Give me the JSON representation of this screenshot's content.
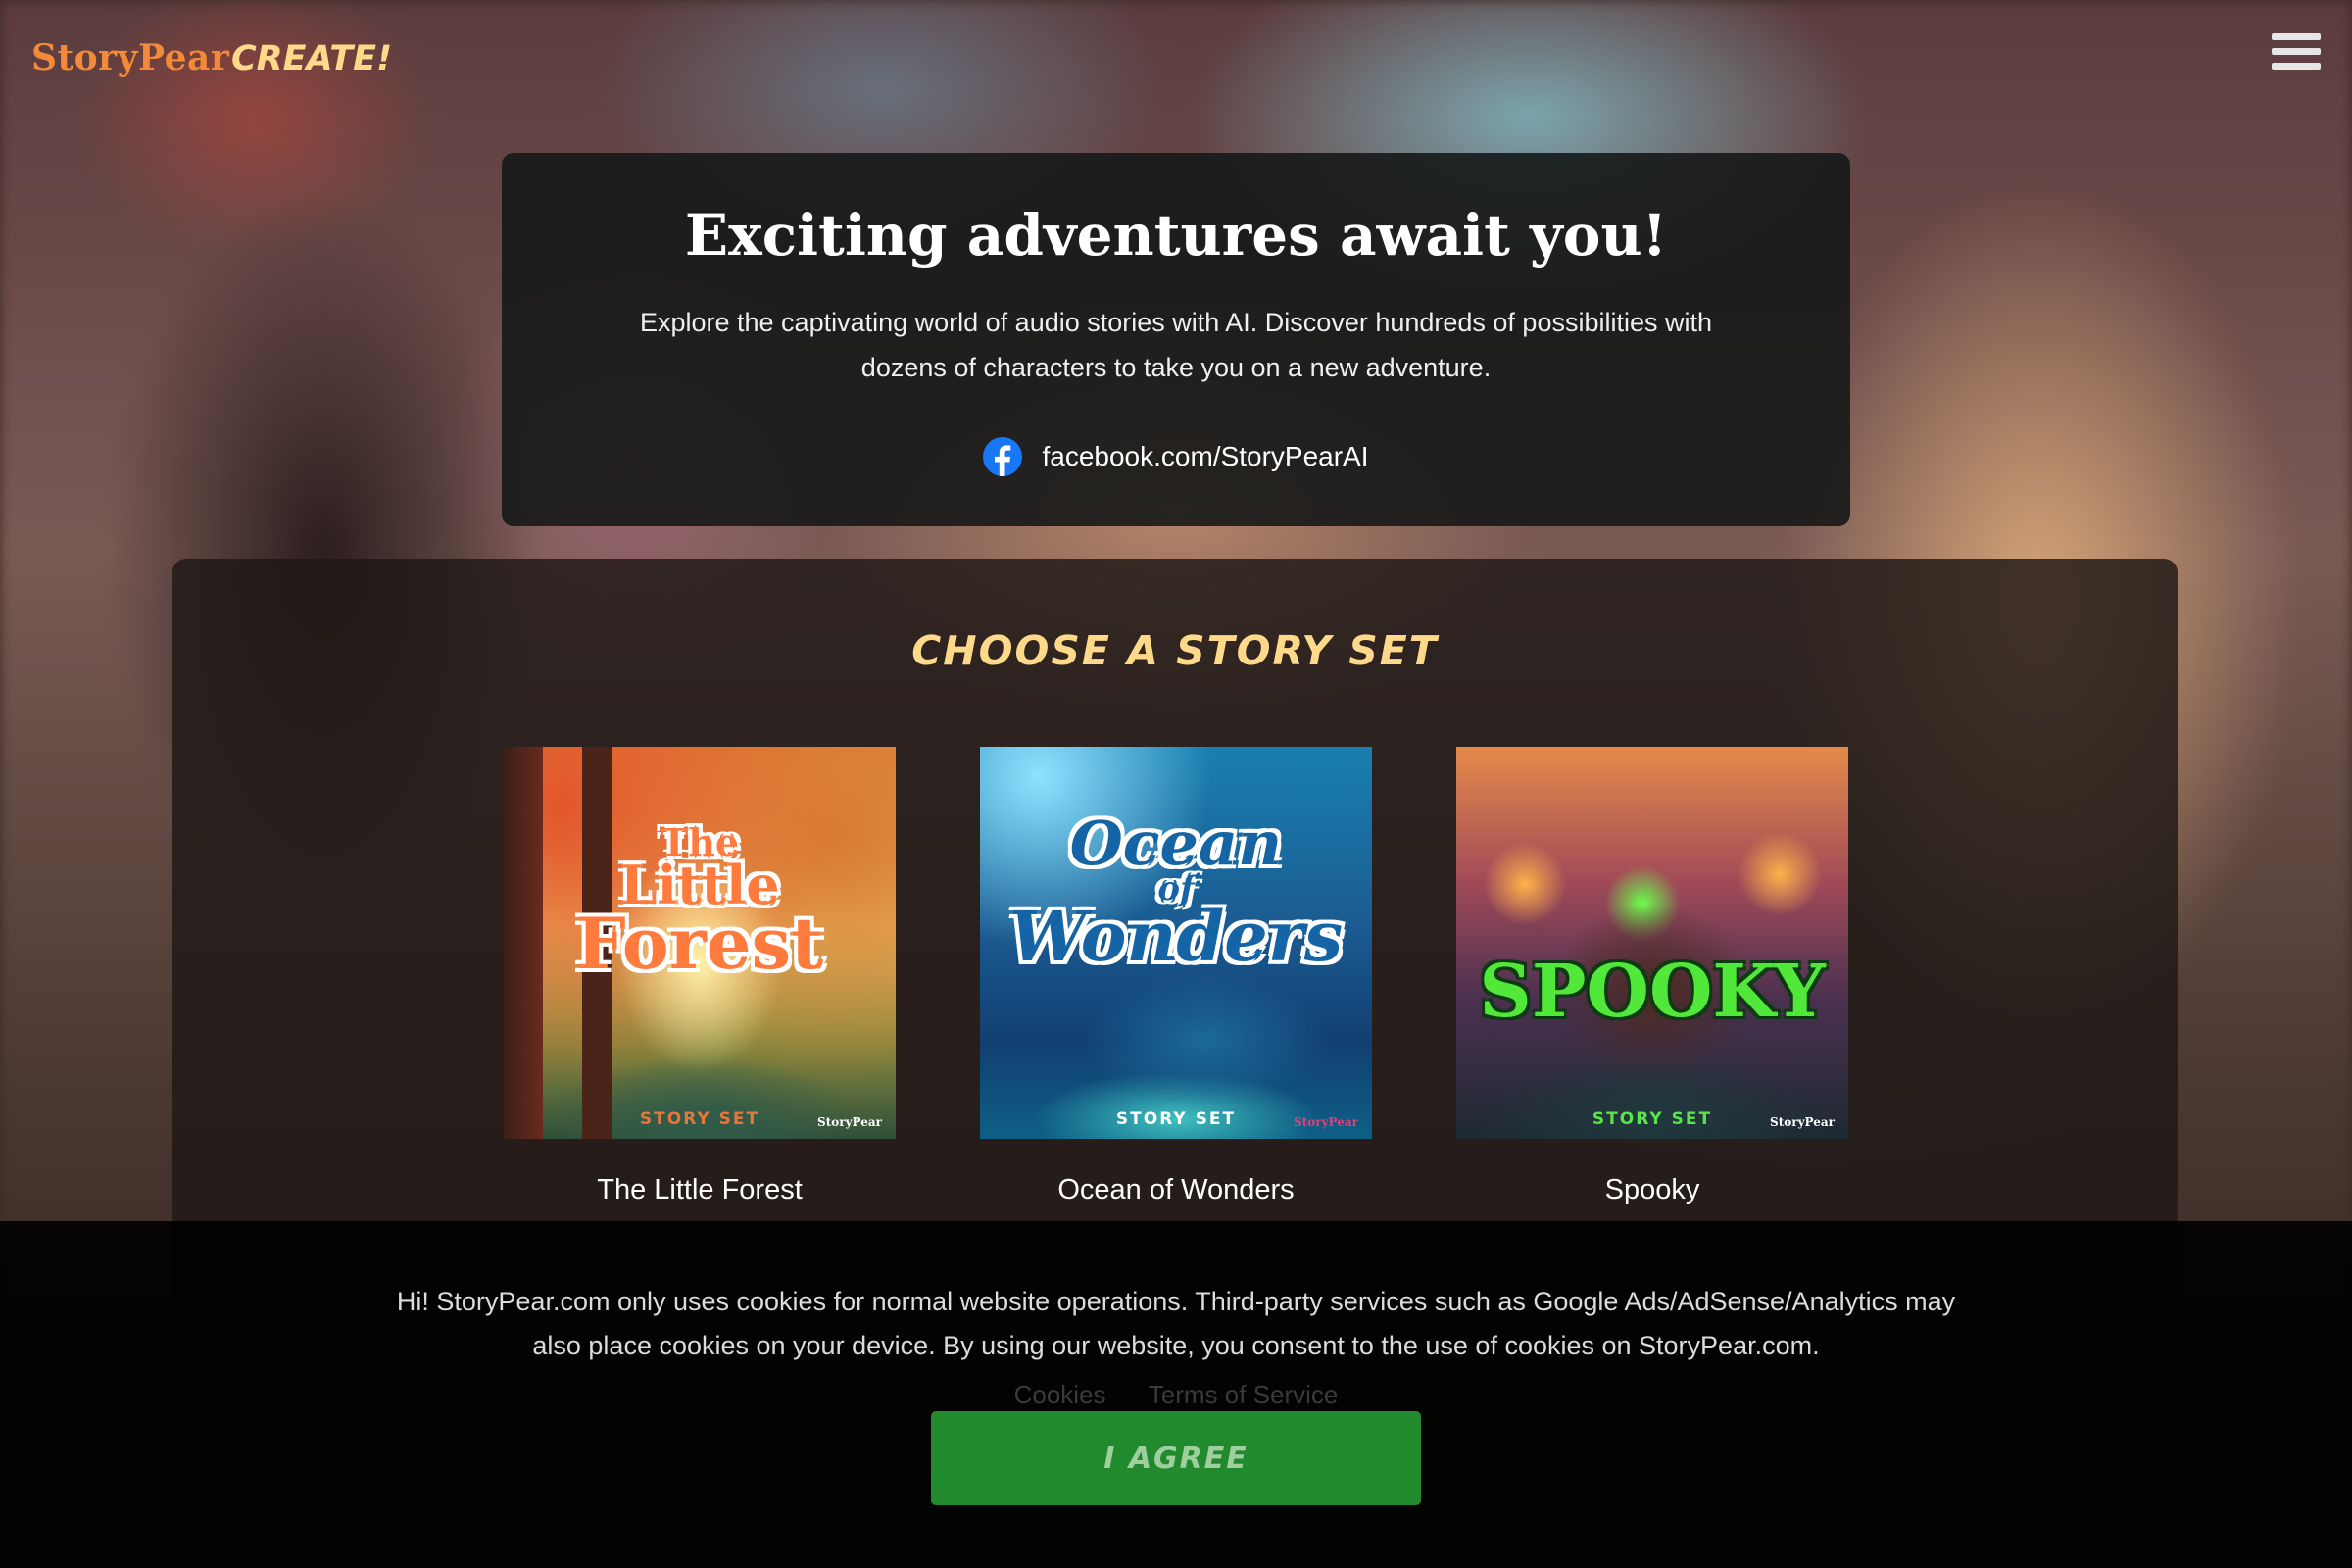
{
  "header": {
    "brand": "StoryPear",
    "brand_suffix": "CREATE!",
    "menu_icon": "hamburger-menu-icon"
  },
  "hero": {
    "title": "Exciting adventures await you!",
    "description": "Explore the captivating world of audio stories with AI. Discover hundreds of possibilities with dozens of characters to take you on a new adventure.",
    "facebook_icon": "facebook-icon",
    "facebook_link": "facebook.com/StoryPearAI"
  },
  "story_sets": {
    "title": "CHOOSE A STORY SET",
    "cards": [
      {
        "title": "The Little Forest",
        "cover_text_lines": [
          "The",
          "Little",
          "Forest"
        ],
        "cover_badge": "STORY SET",
        "cover_brand": "StoryPear",
        "badge_color": "#e8763a"
      },
      {
        "title": "Ocean of Wonders",
        "cover_text_lines": [
          "Ocean",
          "of",
          "Wonders"
        ],
        "cover_badge": "STORY SET",
        "cover_brand": "StoryPear",
        "badge_color": "#ffffff"
      },
      {
        "title": "Spooky",
        "cover_text_lines": [
          "SPOOKY"
        ],
        "cover_badge": "STORY SET",
        "cover_brand": "StoryPear",
        "badge_color": "#5be34a"
      }
    ]
  },
  "cookie_banner": {
    "text": "Hi! StoryPear.com only uses cookies for normal website operations. Third-party services such as Google Ads/AdSense/Analytics may also place cookies on your device. By using our website, you consent to the use of cookies on StoryPear.com.",
    "links": [
      "Cookies",
      "Terms of Service"
    ],
    "agree_button": "I AGREE"
  },
  "colors": {
    "brand_orange": "#f28a3a",
    "accent_yellow": "#ffd98a",
    "agree_green": "#218a2c",
    "facebook_blue": "#1877f2"
  }
}
